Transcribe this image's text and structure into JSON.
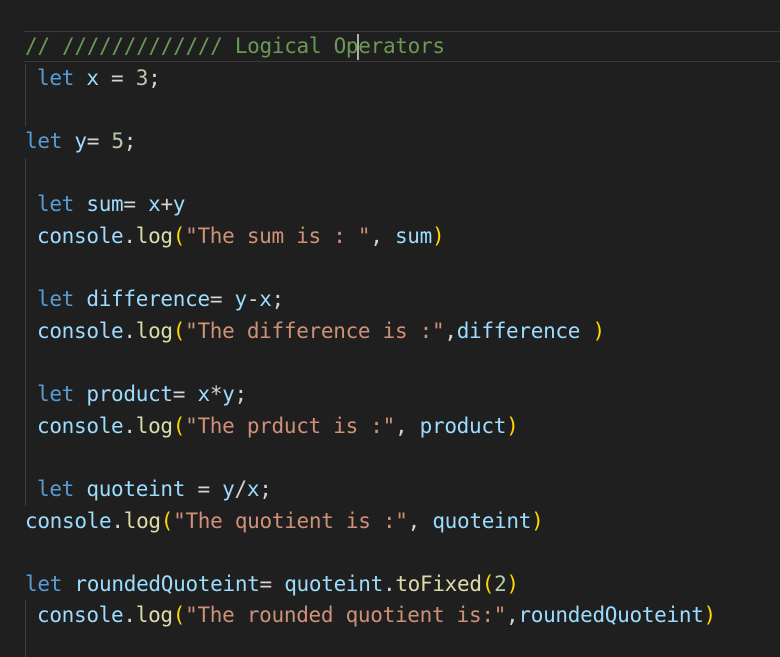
{
  "editor": {
    "lines": [
      "// ///////////// Logical Operators",
      "let x = 3;",
      "let y= 5;",
      "let sum= x+y",
      "console.log(\"The sum is : \", sum)",
      "let difference= y-x;",
      "console.log(\"The difference is :\",difference )",
      "let product= x*y;",
      "console.log(\"The prduct is :\", product)",
      "let quoteint = y/x;",
      "console.log(\"The quotient is :\", quoteint)",
      "let roundedQuoteint= quoteint.toFixed(2)",
      "console.log(\"The rounded quotient is:\",roundedQuoteint)"
    ]
  },
  "tokens": {
    "l1_comment": "// ///////////// Logical Operators",
    "let": "let",
    "console": "console",
    "log": "log",
    "x": "x",
    "y": "y",
    "n3": "3",
    "n5": "5",
    "n2": "2",
    "sum": "sum",
    "difference": "difference",
    "product": "product",
    "quoteint": "quoteint",
    "roundedQuoteint": "roundedQuoteint",
    "toFixed": "toFixed",
    "s_sum": "\"The sum is : \"",
    "s_diff": "\"The difference is :\"",
    "s_prod": "\"The prduct is :\"",
    "s_quot": "\"The quotient is :\"",
    "s_round": "\"The rounded quotient is:\""
  }
}
